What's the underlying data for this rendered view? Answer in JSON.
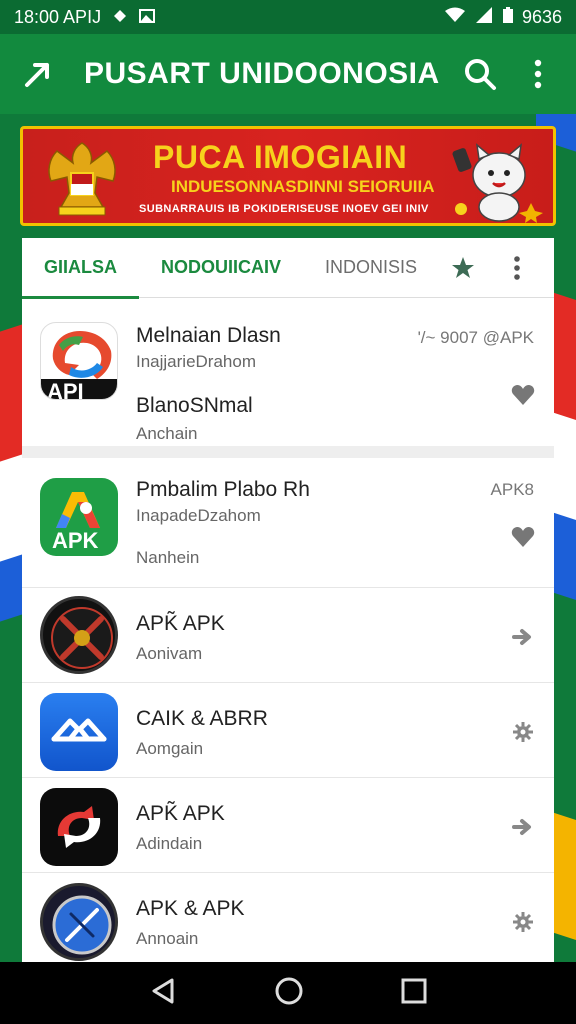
{
  "status_bar": {
    "time": "18:00 APIJ",
    "battery": "9636"
  },
  "app_bar": {
    "title": "PUSART UNIDOONOSIA",
    "icons": [
      "share-arrow-icon",
      "search-icon",
      "more-vert-icon"
    ]
  },
  "banner": {
    "title": "PUCA IMOGIAIN",
    "subtitle": "INDUESONNASDINNI SEIORUIIA",
    "small_text": "SUBNARRAUIS IB POKIDERISEUSE INOEV GEI INIV"
  },
  "tabs": [
    {
      "label": "GIIALSA",
      "active": true
    },
    {
      "label": "NODOUIICAIV",
      "active": false
    },
    {
      "label": "INDONISIS",
      "active": false
    }
  ],
  "tab_icons": [
    "star-icon",
    "more-vert-icon"
  ],
  "apps": [
    {
      "name": "Melnaian Dlasn",
      "publisher": "InajjarieDrahom",
      "name2": "BlanoSNmal",
      "category": "Anchain",
      "meta": "'/~ 9007 @APK",
      "icon_label": "API",
      "action": "heart-icon"
    },
    {
      "name": "Pmbalim Plabo Rh",
      "publisher": "InapadeDzahom",
      "category": "Nanhein",
      "meta": "APK8",
      "icon_label": "APK",
      "action": "heart-icon"
    },
    {
      "name": "APK̃ APK",
      "category": "Aonivam",
      "action": "arrow-icon"
    },
    {
      "name": "CAIK & ABRR",
      "category": "Aomgain",
      "action": "gear-icon"
    },
    {
      "name": "APK̃ APK",
      "category": "Adindain",
      "action": "arrow-icon"
    },
    {
      "name": "APK & APK",
      "category": "Annoain",
      "action": "gear-icon"
    }
  ],
  "nav_bar": [
    "back-icon",
    "home-icon",
    "recents-icon"
  ],
  "colors": {
    "primary_green": "#128a3e",
    "dark_green": "#0b6b32",
    "banner_red": "#d8231f",
    "banner_yellow": "#f7d21c"
  }
}
